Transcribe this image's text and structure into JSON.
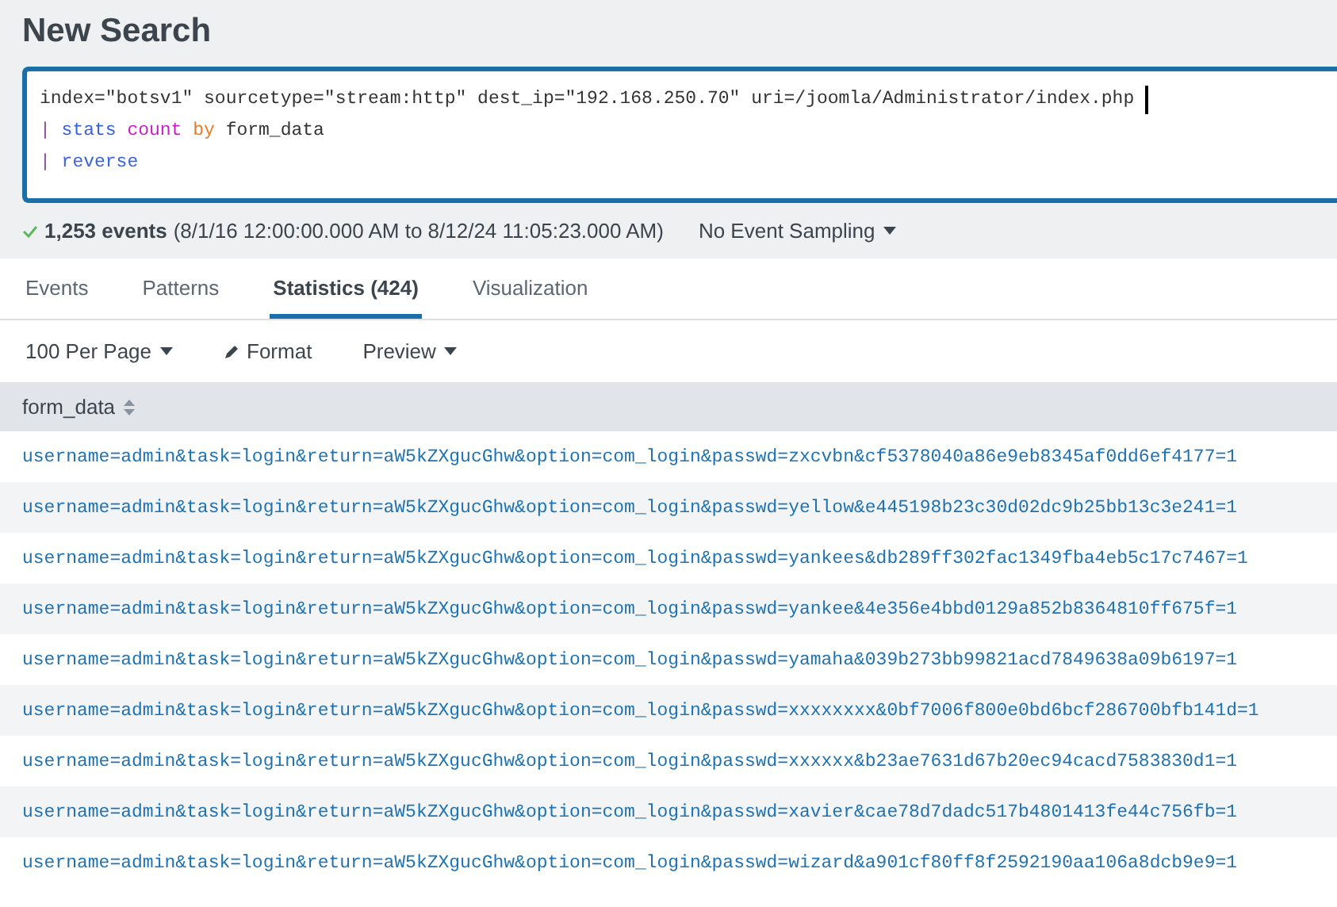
{
  "page_title": "New Search",
  "query": {
    "lines": [
      [
        {
          "kind": "plain",
          "text": "index=\"botsv1\" sourcetype=\"stream:http\" dest_ip=\"192.168.250.70\" uri=/joomla/Administrator/index.php"
        }
      ],
      [
        {
          "kind": "pipe",
          "text": "|"
        },
        {
          "kind": "command",
          "text": "stats"
        },
        {
          "kind": "function",
          "text": "count"
        },
        {
          "kind": "keyword",
          "text": "by"
        },
        {
          "kind": "plain",
          "text": "form_data"
        }
      ],
      [
        {
          "kind": "pipe",
          "text": "|"
        },
        {
          "kind": "command",
          "text": "reverse"
        }
      ]
    ]
  },
  "status": {
    "count": "1,253 events",
    "range": "(8/1/16 12:00:00.000 AM to 8/12/24 11:05:23.000 AM)",
    "sampling": "No Event Sampling"
  },
  "tabs": [
    {
      "label": "Events",
      "selected": false
    },
    {
      "label": "Patterns",
      "selected": false
    },
    {
      "label": "Statistics (424)",
      "selected": true
    },
    {
      "label": "Visualization",
      "selected": false
    }
  ],
  "toolbar": {
    "per_page": "100 Per Page",
    "format": "Format",
    "preview": "Preview"
  },
  "table": {
    "columns": [
      "form_data"
    ],
    "rows": [
      "username=admin&task=login&return=aW5kZXgucGhw&option=com_login&passwd=zxcvbn&cf5378040a86e9eb8345af0dd6ef4177=1",
      "username=admin&task=login&return=aW5kZXgucGhw&option=com_login&passwd=yellow&e445198b23c30d02dc9b25bb13c3e241=1",
      "username=admin&task=login&return=aW5kZXgucGhw&option=com_login&passwd=yankees&db289ff302fac1349fba4eb5c17c7467=1",
      "username=admin&task=login&return=aW5kZXgucGhw&option=com_login&passwd=yankee&4e356e4bbd0129a852b8364810ff675f=1",
      "username=admin&task=login&return=aW5kZXgucGhw&option=com_login&passwd=yamaha&039b273bb99821acd7849638a09b6197=1",
      "username=admin&task=login&return=aW5kZXgucGhw&option=com_login&passwd=xxxxxxxx&0bf7006f800e0bd6bcf286700bfb141d=1",
      "username=admin&task=login&return=aW5kZXgucGhw&option=com_login&passwd=xxxxxx&b23ae7631d67b20ec94cacd7583830d1=1",
      "username=admin&task=login&return=aW5kZXgucGhw&option=com_login&passwd=xavier&cae78d7dadc517b4801413fe44c756fb=1",
      "username=admin&task=login&return=aW5kZXgucGhw&option=com_login&passwd=wizard&a901cf80ff8f2592190aa106a8dcb9e9=1"
    ]
  }
}
